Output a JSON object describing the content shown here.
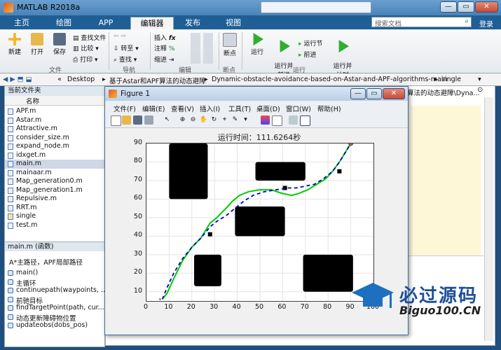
{
  "window": {
    "title": "MATLAB R2018a"
  },
  "search": {
    "placeholder": "搜索文档",
    "login": "登录"
  },
  "tabs": [
    "主页",
    "绘图",
    "APP",
    "编辑器",
    "发布",
    "视图"
  ],
  "ribbon": {
    "new": "新建",
    "open": "打开",
    "save": "保存",
    "find_files": "查找文件",
    "compare": "比较",
    "print": "打印",
    "goto": "转至",
    "find": "查找",
    "insert": "插入",
    "comment": "注释",
    "indent": "缩进",
    "breakpoints": "断点",
    "run": "运行",
    "run_advance": "运行并\n前进",
    "run_section": "运行节",
    "advance": "前进",
    "run_time": "运行并\n计时",
    "groups": {
      "file": "文件",
      "nav": "导航",
      "edit": "编辑",
      "breakpoints": "断点",
      "run": "运行"
    }
  },
  "address": {
    "parts": [
      "«",
      "Desktop",
      "基于Astar和APF算法的动态避障",
      "Dynamic-obstacle-avoidance-based-on-Astar-and-APF-algorithms-main",
      "single"
    ]
  },
  "current_folder": {
    "title": "当前文件夹",
    "col_name": "名称",
    "files": [
      "APF.m",
      "Astar.m",
      "Attractive.m",
      "consider_size.m",
      "expand_node.m",
      "idxget.m",
      "main.m",
      "mainaar.m",
      "Map_generation0.m",
      "Map_generation1.m",
      "Repulsive.m",
      "RRT.m",
      "single",
      "test.m"
    ],
    "selected": "main.m"
  },
  "details": {
    "title": "main.m  (函数)",
    "description": "A*主路径，APF局部路径",
    "functions": [
      "main()",
      "主循环",
      "continuepath(waypoints, ...",
      "前驰目标",
      "findTargetPoint(path, cur...",
      "动态更新障碍物位置",
      "updateobs(dobs_pos)"
    ]
  },
  "editor_path": "算法的动态避障\\Dyna...",
  "figure": {
    "title": "Figure 1",
    "menu": [
      "文件(F)",
      "编辑(E)",
      "查看(V)",
      "插入(I)",
      "工具(T)",
      "桌面(D)",
      "窗口(W)",
      "帮助(H)"
    ]
  },
  "chart_data": {
    "type": "line",
    "title": "运行时间：111.6264秒",
    "xlim": [
      0,
      100
    ],
    "ylim": [
      5,
      90
    ],
    "xticks": [
      "0",
      "10",
      "20",
      "30",
      "40",
      "50",
      "60",
      "70",
      "80",
      "90",
      "100"
    ],
    "yticks": [
      "10",
      "20",
      "30",
      "40",
      "50",
      "60",
      "70",
      "80",
      "90"
    ],
    "grid": true,
    "obstacles": [
      {
        "x": [
          10,
          27
        ],
        "y": [
          60,
          90
        ]
      },
      {
        "x": [
          39,
          61
        ],
        "y": [
          40,
          56
        ]
      },
      {
        "x": [
          48,
          70
        ],
        "y": [
          70,
          80
        ]
      },
      {
        "x": [
          21,
          33
        ],
        "y": [
          13,
          30
        ]
      },
      {
        "x": [
          69,
          91
        ],
        "y": [
          10,
          30
        ]
      }
    ],
    "dynamic_obstacles": [
      {
        "x": 28,
        "y": 41
      },
      {
        "x": 61,
        "y": 66
      },
      {
        "x": 85,
        "y": 75
      }
    ],
    "series": [
      {
        "color": "#00cc00",
        "style": "solid",
        "x": [
          7,
          9,
          12,
          16,
          20,
          24,
          26,
          28,
          31,
          35,
          38,
          41,
          45,
          50,
          55,
          60,
          64,
          67,
          71,
          75,
          79,
          82,
          85,
          87,
          89,
          90
        ],
        "y": [
          6,
          9,
          17,
          27,
          34,
          39,
          43,
          47,
          50,
          55,
          59,
          62,
          64,
          65,
          65,
          63,
          62,
          63,
          65,
          68,
          71,
          75,
          80,
          84,
          88,
          90
        ]
      },
      {
        "color": "#0000cc",
        "style": "dashed",
        "x": [
          7,
          9,
          12,
          16,
          20,
          24,
          28,
          31,
          35,
          39,
          43,
          47,
          52,
          57,
          62,
          66,
          70,
          74,
          78,
          82,
          85,
          87,
          89,
          90
        ],
        "y": [
          6,
          12,
          20,
          28,
          34,
          39,
          45,
          48,
          51,
          55,
          59,
          62,
          64,
          65,
          66,
          66,
          67,
          68,
          71,
          75,
          80,
          84,
          88,
          90
        ]
      }
    ],
    "start": {
      "x": 6,
      "y": 6
    },
    "goal": {
      "x": 90,
      "y": 90
    }
  },
  "watermark": {
    "line1": "必过源码",
    "line2": "Biguo100.CN"
  },
  "colors": {
    "accent": "#1f5f96",
    "green_path": "#00cc00",
    "blue_path": "#0000cc"
  }
}
